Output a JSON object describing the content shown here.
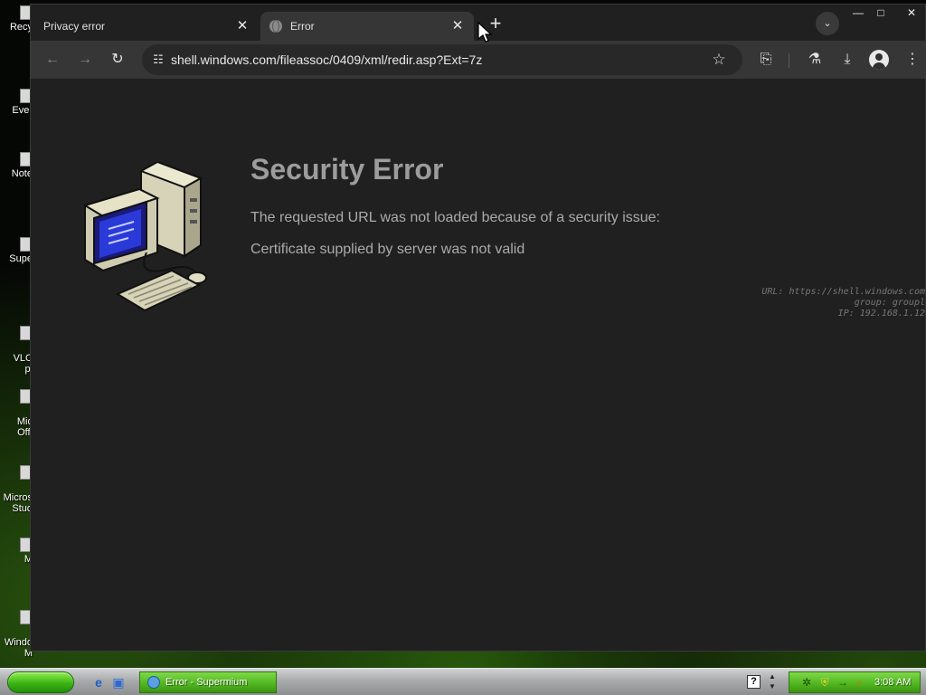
{
  "desktop": {
    "icons": [
      {
        "label": "Recy"
      },
      {
        "label": "Ever"
      },
      {
        "label": "Note"
      },
      {
        "label": "Supe"
      },
      {
        "label": "VLC\npl"
      },
      {
        "label": "Mic\nOffi"
      },
      {
        "label": "Micros\nStud"
      },
      {
        "label": "M"
      },
      {
        "label": "Windo\nM"
      }
    ]
  },
  "browser": {
    "tabs": [
      {
        "title": "Privacy error",
        "active": false
      },
      {
        "title": "Error",
        "active": true
      }
    ],
    "new_tab_label": "+",
    "toolbar": {
      "url": "shell.windows.com/fileassoc/0409/xml/redir.asp?Ext=7z"
    }
  },
  "page": {
    "title": "Security Error",
    "message": "The requested URL was not loaded because of a security issue:",
    "detail": "Certificate supplied by server was not valid",
    "diagnostics": {
      "url_line": "URL: https://shell.windows.com",
      "group_line": "group: groupl",
      "ip_line": "IP: 192.168.1.12"
    }
  },
  "taskbar": {
    "task_label": "Error - Supermium",
    "clock": "3:08 AM"
  },
  "colors": {
    "page_background": "#202020",
    "title_text": "#9c9c9c",
    "body_text": "#aaaaaa",
    "taskbar_green": "#4fb41e"
  },
  "icons": {
    "page_art": "computer-icon",
    "tab_favicon": "globe-icon",
    "address_tune": "tune-icon"
  }
}
